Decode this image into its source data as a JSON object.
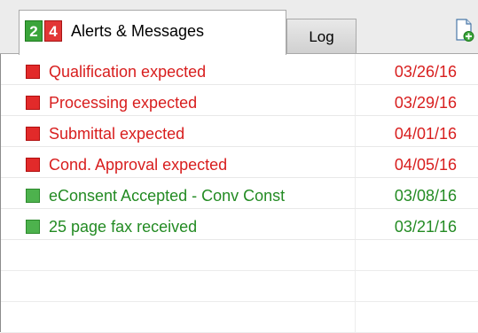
{
  "tabs": {
    "active": {
      "badge_green": "2",
      "badge_red": "4",
      "label": "Alerts & Messages"
    },
    "log_label": "Log"
  },
  "toolbar": {
    "new_item_icon": "new-document-icon"
  },
  "colors": {
    "alert": "#d81e1e",
    "message": "#238b23"
  },
  "rows": [
    {
      "type": "alert",
      "text": "Qualification expected",
      "date": "03/26/16"
    },
    {
      "type": "alert",
      "text": "Processing expected",
      "date": "03/29/16"
    },
    {
      "type": "alert",
      "text": "Submittal expected",
      "date": "04/01/16"
    },
    {
      "type": "alert",
      "text": "Cond. Approval expected",
      "date": "04/05/16"
    },
    {
      "type": "message",
      "text": "eConsent Accepted - Conv Const",
      "date": "03/08/16"
    },
    {
      "type": "message",
      "text": "25 page fax received",
      "date": "03/21/16"
    }
  ]
}
